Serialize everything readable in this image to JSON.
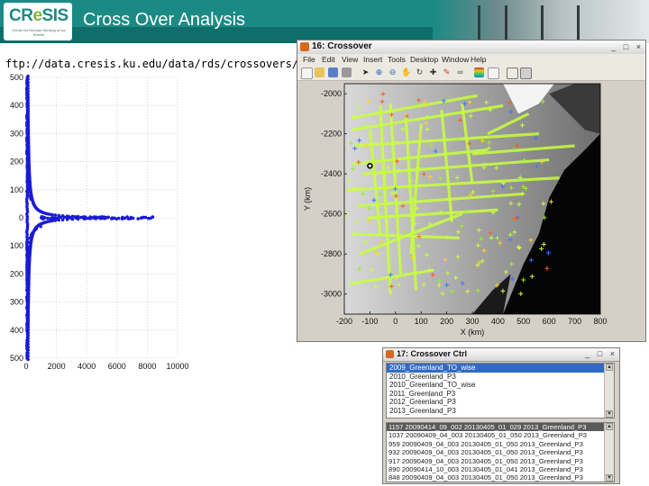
{
  "header": {
    "logo": {
      "text_cre": "CR",
      "text_e": "e",
      "text_sis": "SIS",
      "tagline": "Center for Remote Sensing of Ice Sheets"
    },
    "title": "Cross Over Analysis"
  },
  "url": "ftp://data.cresis.ku.edu/data/rds/crossovers/",
  "left_plot": {
    "y_ticks": [
      "500",
      "400",
      "300",
      "200",
      "100",
      "0",
      "100",
      "200",
      "300",
      "400",
      "500"
    ],
    "y_values": [
      500,
      400,
      300,
      200,
      100,
      0,
      -100,
      -200,
      -300,
      -400,
      -500
    ],
    "x_ticks": [
      "0",
      "2000",
      "4000",
      "6000",
      "8000",
      "10000"
    ],
    "x_values": [
      0,
      2000,
      4000,
      6000,
      8000,
      10000
    ],
    "series_color": "#1a1ad6"
  },
  "matlab_window": {
    "title": "16: Crossover",
    "window_buttons": "_ □ ×",
    "menu": [
      "File",
      "Edit",
      "View",
      "Insert",
      "Tools",
      "Desktop",
      "Window",
      "Help"
    ],
    "toolbar_icons": [
      "new-icon",
      "open-icon",
      "save-icon",
      "print-icon",
      "pointer-icon",
      "zoom-in-icon",
      "zoom-out-icon",
      "pan-icon",
      "rotate-icon",
      "data-cursor-icon",
      "brush-icon",
      "link-icon",
      "colorbar-icon",
      "legend-icon",
      "grid-icon",
      "dock-icon"
    ],
    "y_label": "Y (km)",
    "x_label": "X (km)",
    "y_ticks": [
      "-2000",
      "-2200",
      "-2400",
      "-2600",
      "-2800",
      "-3000"
    ],
    "x_ticks": [
      "-200",
      "-100",
      "0",
      "100",
      "200",
      "300",
      "400",
      "500",
      "600",
      "700",
      "800"
    ],
    "crossover_color": "#c8ff3c"
  },
  "ctrl_window": {
    "title": "17: Crossover Ctrl",
    "window_buttons": "_ □ ×",
    "seasons": [
      "2009_Greenland_TO_wise",
      "2010_Greenland_P3",
      "2010_Greenland_TO_wise",
      "2011_Greenland_P3",
      "2012_Greenland_P3",
      "2013_Greenland_P3"
    ],
    "crossovers": [
      "1157 20090414_09_002 20130405_01_029 2013_Greenland_P3",
      "1037 20090409_04_003 20130405_01_050 2013_Greenland_P3",
      "959 20090409_04_003 20130405_01_050 2013_Greenland_P3",
      "932 20090409_04_003 20130405_01_050 2013_Greenland_P3",
      "917 20090409_04_003 20130405_01_050 2013_Greenland_P3",
      "890 20090414_10_003 20130405_01_041 2013_Greenland_P3",
      "848 20090409_04_003 20130405_01_050 2013_Greenland_P3"
    ]
  }
}
